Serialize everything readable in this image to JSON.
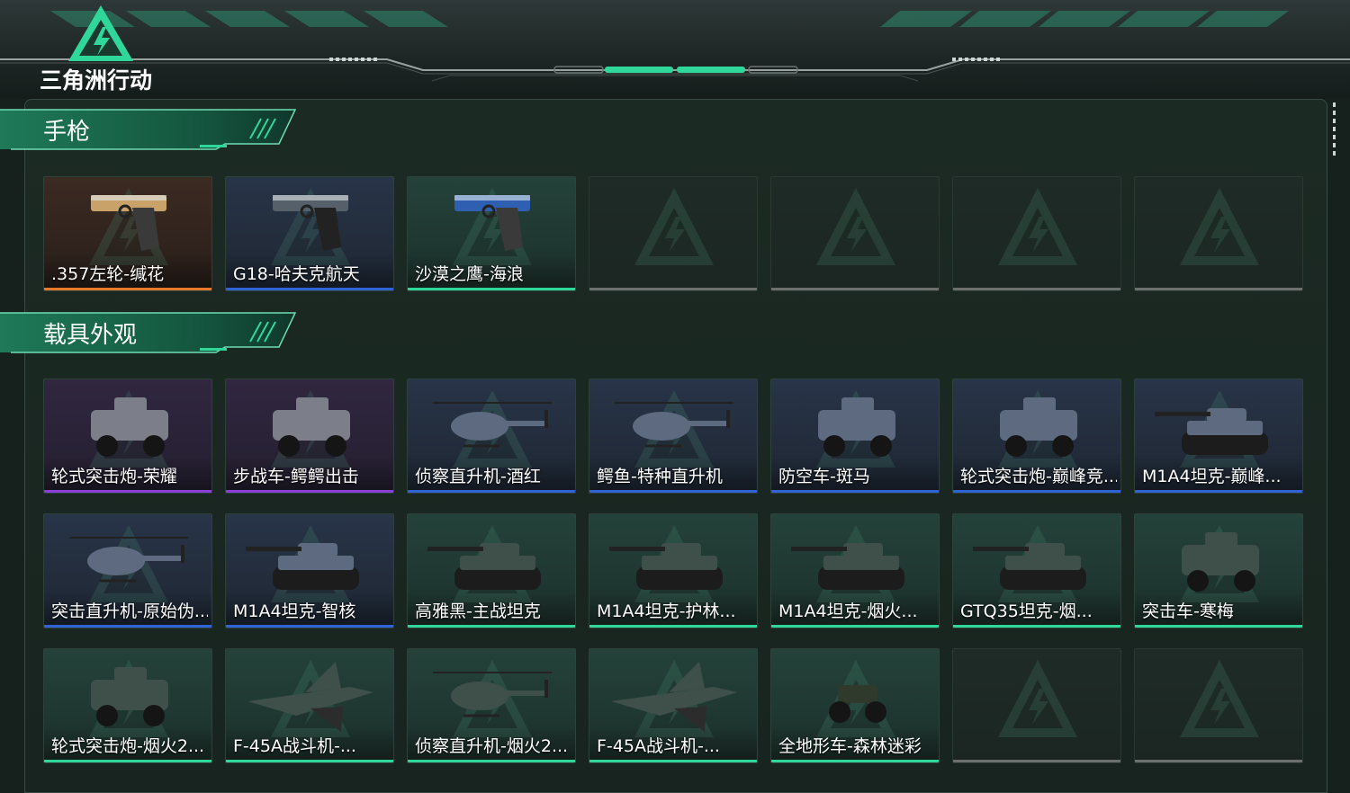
{
  "brand": {
    "logo_text": "三角洲行动",
    "accent": "#2fd79b"
  },
  "colors": {
    "orange": "#e8782a",
    "blue": "#2f63d6",
    "purple": "#8a3fd6",
    "green": "#2fd79b",
    "empty": "#6b6f6d"
  },
  "sections": [
    {
      "title": "手枪",
      "items": [
        {
          "label": ".357左轮-缄花",
          "rarity": "orange",
          "icon": "revolver-icon"
        },
        {
          "label": "G18-哈夫克航天",
          "rarity": "blue",
          "icon": "pistol-icon"
        },
        {
          "label": "沙漠之鹰-海浪",
          "rarity": "green",
          "icon": "desert-eagle-icon"
        },
        {
          "label": "",
          "rarity": "empty"
        },
        {
          "label": "",
          "rarity": "empty"
        },
        {
          "label": "",
          "rarity": "empty"
        },
        {
          "label": "",
          "rarity": "empty"
        }
      ]
    },
    {
      "title": "载具外观",
      "items": [
        {
          "label": "轮式突击炮-荣耀",
          "rarity": "purple",
          "icon": "armored-car-icon"
        },
        {
          "label": "步战车-鳄鳄出击",
          "rarity": "purple",
          "icon": "ifv-icon"
        },
        {
          "label": "侦察直升机-酒红",
          "rarity": "blue",
          "icon": "helicopter-icon"
        },
        {
          "label": "鳄鱼-特种直升机",
          "rarity": "blue",
          "icon": "attack-helicopter-icon"
        },
        {
          "label": "防空车-斑马",
          "rarity": "blue",
          "icon": "aa-vehicle-icon"
        },
        {
          "label": "轮式突击炮-巅峰竞...",
          "rarity": "blue",
          "icon": "armored-car-icon"
        },
        {
          "label": "M1A4坦克-巅峰...",
          "rarity": "blue",
          "icon": "tank-icon"
        },
        {
          "label": "突击直升机-原始伪...",
          "rarity": "blue",
          "icon": "attack-helicopter-icon"
        },
        {
          "label": "M1A4坦克-智核",
          "rarity": "blue",
          "icon": "tank-icon"
        },
        {
          "label": "高雅黑-主战坦克",
          "rarity": "green",
          "icon": "tank-icon"
        },
        {
          "label": "M1A4坦克-护林...",
          "rarity": "green",
          "icon": "tank-icon"
        },
        {
          "label": "M1A4坦克-烟火...",
          "rarity": "green",
          "icon": "tank-icon"
        },
        {
          "label": "GTQ35坦克-烟...",
          "rarity": "green",
          "icon": "tank-icon"
        },
        {
          "label": "突击车-寒梅",
          "rarity": "green",
          "icon": "assault-vehicle-icon"
        },
        {
          "label": "轮式突击炮-烟火2...",
          "rarity": "green",
          "icon": "armored-car-icon"
        },
        {
          "label": "F-45A战斗机-...",
          "rarity": "green",
          "icon": "fighter-jet-icon"
        },
        {
          "label": "侦察直升机-烟火2...",
          "rarity": "green",
          "icon": "helicopter-icon"
        },
        {
          "label": "F-45A战斗机-...",
          "rarity": "green",
          "icon": "fighter-jet-icon"
        },
        {
          "label": "全地形车-森林迷彩",
          "rarity": "green",
          "icon": "atv-icon"
        },
        {
          "label": "",
          "rarity": "empty"
        },
        {
          "label": "",
          "rarity": "empty"
        }
      ]
    }
  ]
}
